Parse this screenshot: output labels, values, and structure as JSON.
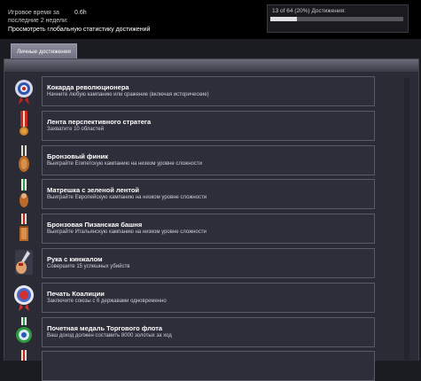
{
  "stats": {
    "playtime_label_line1": "Игровое время за",
    "playtime_label_line2": "последние 2 недели:",
    "playtime_value": "0.6h",
    "global_stats_link": "Просмотреть глобальную статистику достижений"
  },
  "progress": {
    "label": "13 of 64 (20%) Достижения:",
    "percent": 20
  },
  "tabs": [
    {
      "label": "Личные достижения",
      "active": true
    }
  ],
  "achievements": [
    {
      "title": "Кокарда революционера",
      "desc": "Начните любую кампанию или сражение (включая исторические)",
      "icon": "cockade-rosette-icon"
    },
    {
      "title": "Лента перспективного стратега",
      "desc": "Захватите 10 областей",
      "icon": "red-ribbon-medal-icon"
    },
    {
      "title": "Бронзовый финик",
      "desc": "Выиграйте Египетскую кампанию на низком уровне сложности",
      "icon": "bronze-date-medal-icon"
    },
    {
      "title": "Матрешка с зеленой лентой",
      "desc": "Выиграйте Европейскую кампанию на низком уровне сложности",
      "icon": "green-ribbon-doll-medal-icon"
    },
    {
      "title": "Бронзовая Пизанская башня",
      "desc": "Выиграйте Итальянскую кампанию на низком уровне сложности",
      "icon": "bronze-tower-medal-icon"
    },
    {
      "title": "Рука с кинжалом",
      "desc": "Совершите 15 успешных убийств",
      "icon": "hand-dagger-medal-icon"
    },
    {
      "title": "Печать Коалиции",
      "desc": "Заключите союзы с 6 державами одновременно",
      "icon": "coalition-seal-icon"
    },
    {
      "title": "Почетная медаль Торгового флота",
      "desc": "Ваш доход должен составить 8000 золотых за ход",
      "icon": "trade-fleet-medal-icon"
    },
    {
      "title": "",
      "desc": "",
      "icon": "partial-medal-icon"
    }
  ]
}
